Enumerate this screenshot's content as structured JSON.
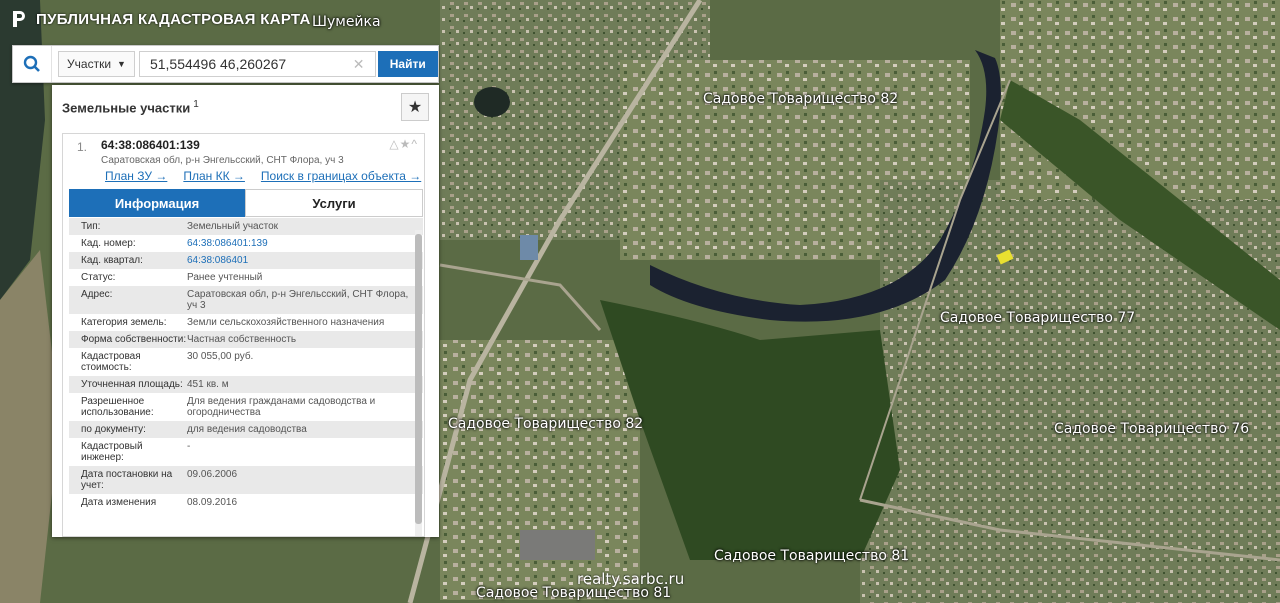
{
  "app": {
    "title": "ПУБЛИЧНАЯ КАДАСТРОВАЯ КАРТА"
  },
  "search": {
    "scope": "Участки",
    "query": "51,554496 46,260267",
    "find_label": "Найти"
  },
  "panel": {
    "title": "Земельные участки",
    "count": "1",
    "result": {
      "index": "1.",
      "cadastral_id": "64:38:086401:139",
      "address": "Саратовская обл, р-н Энгельсский, СНТ Флора, уч 3",
      "links": [
        "План ЗУ →",
        "План КК →",
        "Поиск в границах объекта →"
      ],
      "tabs": [
        "Информация",
        "Услуги"
      ],
      "rows": [
        {
          "k": "Тип:",
          "v": "Земельный участок"
        },
        {
          "k": "Кад. номер:",
          "v": "64:38:086401:139"
        },
        {
          "k": "Кад. квартал:",
          "v": "64:38:086401"
        },
        {
          "k": "Статус:",
          "v": "Ранее учтенный"
        },
        {
          "k": "Адрес:",
          "v": "Саратовская обл, р-н Энгельсский, СНТ Флора, уч 3"
        },
        {
          "k": "Категория земель:",
          "v": "Земли сельскохозяйственного назначения"
        },
        {
          "k": "Форма собственности:",
          "v": "Частная собственность"
        },
        {
          "k": "Кадастровая стоимость:",
          "v": "30 055,00 руб."
        },
        {
          "k": "Уточненная площадь:",
          "v": "451 кв. м"
        },
        {
          "k": "Разрешенное использование:",
          "v": "Для ведения гражданами садоводства и огородничества"
        },
        {
          "k": "по документу:",
          "v": "для ведения садоводства"
        },
        {
          "k": "Кадастровый инженер:",
          "v": "-"
        },
        {
          "k": "Дата постановки на учет:",
          "v": "09.06.2006"
        },
        {
          "k": "Дата изменения",
          "v": "08.09.2016"
        }
      ]
    }
  },
  "map": {
    "labels": [
      "Шумейка",
      "Садовое Товарищество 82",
      "Садовое Товарищество 77",
      "Садовое Товарищество 82",
      "Садовое Товарищество 76",
      "Садовое Товарищество 81",
      "Садовое Товарищество 81"
    ],
    "watermark": "realty.sarbc.ru",
    "colors": {
      "river": "#1b2230",
      "water_dark": "#2b3a30",
      "forest": "#2f4a22",
      "fields": "#6d7d52",
      "parcel": "#e8e030"
    }
  },
  "colors": {
    "accent": "#1d6fb8"
  }
}
